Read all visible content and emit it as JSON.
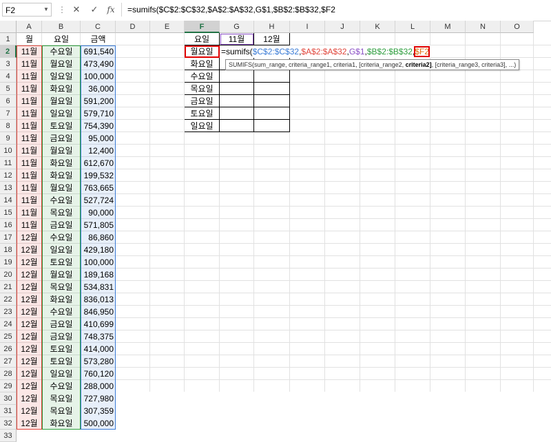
{
  "formula_bar": {
    "name_box": "F2",
    "cancel_icon": "✕",
    "enter_icon": "✓",
    "fx_label": "fx",
    "formula": "=sumifs($C$2:$C$32,$A$2:$A$32,G$1,$B$2:$B$32,$F2"
  },
  "columns": [
    "A",
    "B",
    "C",
    "D",
    "E",
    "F",
    "G",
    "H",
    "I",
    "J",
    "K",
    "L",
    "M",
    "N",
    "O"
  ],
  "rows": [
    "1",
    "2",
    "3",
    "4",
    "5",
    "6",
    "7",
    "8",
    "9",
    "10",
    "11",
    "12",
    "13",
    "14",
    "15",
    "16",
    "17",
    "18",
    "19",
    "20",
    "21",
    "22",
    "23",
    "24",
    "25",
    "26",
    "27",
    "28",
    "29",
    "30",
    "31",
    "32",
    "33"
  ],
  "headers": {
    "a": "월",
    "b": "요일",
    "c": "금액"
  },
  "data": [
    [
      "11월",
      "수요일",
      "691,540"
    ],
    [
      "11월",
      "월요일",
      "473,490"
    ],
    [
      "11월",
      "일요일",
      "100,000"
    ],
    [
      "11월",
      "화요일",
      "36,000"
    ],
    [
      "11월",
      "월요일",
      "591,200"
    ],
    [
      "11월",
      "일요일",
      "579,710"
    ],
    [
      "11월",
      "토요일",
      "754,390"
    ],
    [
      "11월",
      "금요일",
      "95,000"
    ],
    [
      "11월",
      "월요일",
      "12,400"
    ],
    [
      "11월",
      "화요일",
      "612,670"
    ],
    [
      "11월",
      "화요일",
      "199,532"
    ],
    [
      "11월",
      "월요일",
      "763,665"
    ],
    [
      "11월",
      "수요일",
      "527,724"
    ],
    [
      "11월",
      "목요일",
      "90,000"
    ],
    [
      "11월",
      "금요일",
      "571,805"
    ],
    [
      "12월",
      "수요일",
      "86,860"
    ],
    [
      "12월",
      "일요일",
      "429,180"
    ],
    [
      "12월",
      "토요일",
      "100,000"
    ],
    [
      "12월",
      "월요일",
      "189,168"
    ],
    [
      "12월",
      "목요일",
      "534,831"
    ],
    [
      "12월",
      "화요일",
      "836,013"
    ],
    [
      "12월",
      "수요일",
      "846,950"
    ],
    [
      "12월",
      "금요일",
      "410,699"
    ],
    [
      "12월",
      "금요일",
      "748,375"
    ],
    [
      "12월",
      "토요일",
      "414,000"
    ],
    [
      "12월",
      "토요일",
      "573,280"
    ],
    [
      "12월",
      "일요일",
      "760,120"
    ],
    [
      "12월",
      "수요일",
      "288,000"
    ],
    [
      "12월",
      "목요일",
      "727,980"
    ],
    [
      "12월",
      "목요일",
      "307,359"
    ],
    [
      "12월",
      "화요일",
      "500,000"
    ]
  ],
  "summary": {
    "header_day": "요일",
    "header_nov": "11월",
    "header_dec": "12월",
    "days": [
      "월요일",
      "화요일",
      "수요일",
      "목요일",
      "금요일",
      "토요일",
      "일요일"
    ]
  },
  "edit": {
    "prefix": "=sumifs(",
    "arg1": "$C$2:$C$32",
    "arg2": "$A$2:$A$32",
    "arg3": "G$1",
    "arg4": "$B$2:$B$32",
    "arg5": "$F2",
    "comma": ","
  },
  "tooltip": {
    "text_before": "SUMIFS(sum_range, criteria_range1, criteria1, [criteria_range2, ",
    "bold": "criteria2]",
    "text_after": ", [criteria_range3, criteria3], ...)"
  },
  "colors": {
    "ref1": "#3a7bd5",
    "ref2": "#e0463c",
    "ref3": "#8a4fc5",
    "ref4": "#2e9e3e",
    "ref5": "#e36c0a",
    "selection": "#e00000"
  }
}
